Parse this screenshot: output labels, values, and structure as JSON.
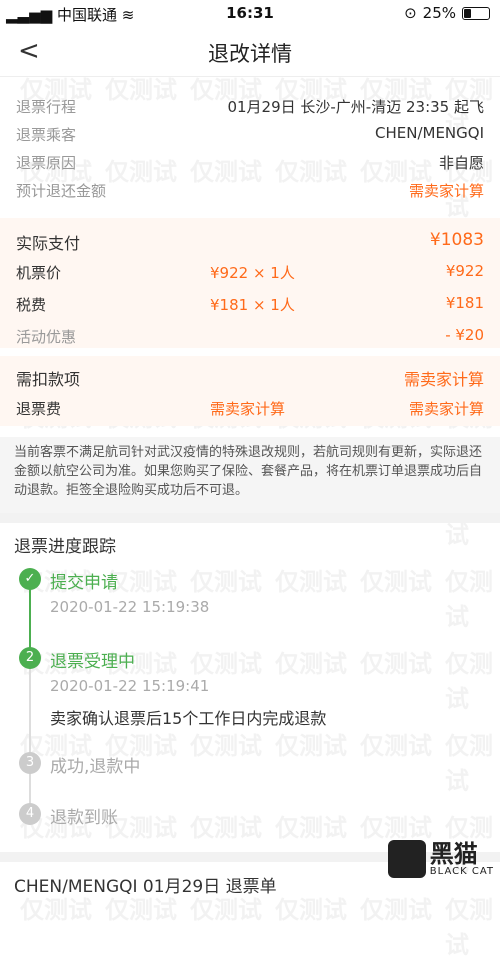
{
  "status_bar": {
    "carrier": "中国联通",
    "time": "16:31",
    "battery": "25%",
    "battery_level": 0.25
  },
  "nav": {
    "back_symbol": "<",
    "title": "退改详情"
  },
  "refund_info": [
    {
      "label": "退票行程",
      "value": "01月29日 长沙-广州-清迈 23:35 起飞"
    },
    {
      "label": "退票乘客",
      "value": "CHEN/MENGQI"
    },
    {
      "label": "退票原因",
      "value": "非自愿"
    },
    {
      "label": "预计退还金额",
      "value": "需卖家计算"
    }
  ],
  "payment": {
    "actual": {
      "label": "实际支付",
      "value": "¥1083"
    },
    "ticket": {
      "label": "机票价",
      "detail": "¥922 × 1人",
      "value": "¥922"
    },
    "tax": {
      "label": "税费",
      "detail": "¥181 × 1人",
      "value": "¥181"
    },
    "promo": {
      "label": "活动优惠",
      "value": "- ¥20"
    }
  },
  "deduction": {
    "total": {
      "label": "需扣款项",
      "value": "需卖家计算"
    },
    "fee": {
      "label": "退票费",
      "detail": "需卖家计算",
      "value": "需卖家计算"
    }
  },
  "notice": "当前客票不满足航司针对武汉疫情的特殊退改规则，若航司规则有更新，实际退还金额以航空公司为准。如果您购买了保险、套餐产品，将在机票订单退票成功后自动退款。拒签全退险购买成功后不可退。",
  "tracking": {
    "title": "退票进度跟踪",
    "steps": [
      {
        "num": "✓",
        "label": "提交申请",
        "time": "2020-01-22 15:19:38"
      },
      {
        "num": "2",
        "label": "退票受理中",
        "time": "2020-01-22 15:19:41",
        "note": "卖家确认退票后15个工作日内完成退款"
      },
      {
        "num": "3",
        "label": "成功,退款中"
      },
      {
        "num": "4",
        "label": "退款到账"
      }
    ]
  },
  "watermark": "仅测试",
  "brand": {
    "name": "黑猫",
    "sub": "BLACK CAT"
  },
  "bottom_partial": "CHEN/MENGQI 01月29日 退票单",
  "colors": {
    "accent": "#ff6a1a",
    "success": "#4caf50",
    "muted": "#cccccc"
  }
}
